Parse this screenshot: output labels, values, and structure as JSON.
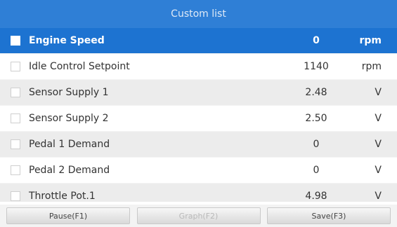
{
  "header": {
    "title": "Custom list"
  },
  "rows": [
    {
      "name": "Engine Speed",
      "value": "0",
      "unit": "rpm"
    },
    {
      "name": "Idle Control Setpoint",
      "value": "1140",
      "unit": "rpm"
    },
    {
      "name": "Sensor Supply 1",
      "value": "2.48",
      "unit": "V"
    },
    {
      "name": "Sensor Supply 2",
      "value": "2.50",
      "unit": "V"
    },
    {
      "name": "Pedal 1 Demand",
      "value": "0",
      "unit": "V"
    },
    {
      "name": "Pedal 2 Demand",
      "value": "0",
      "unit": "V"
    },
    {
      "name": "Throttle Pot.1",
      "value": "4.98",
      "unit": "V"
    }
  ],
  "buttons": {
    "pause": "Pause(F1)",
    "graph": "Graph(F2)",
    "save": "Save(F3)"
  },
  "colors": {
    "header": "#2f7fd6",
    "selected_row": "#1d73d1",
    "alt_row": "#ececec"
  }
}
